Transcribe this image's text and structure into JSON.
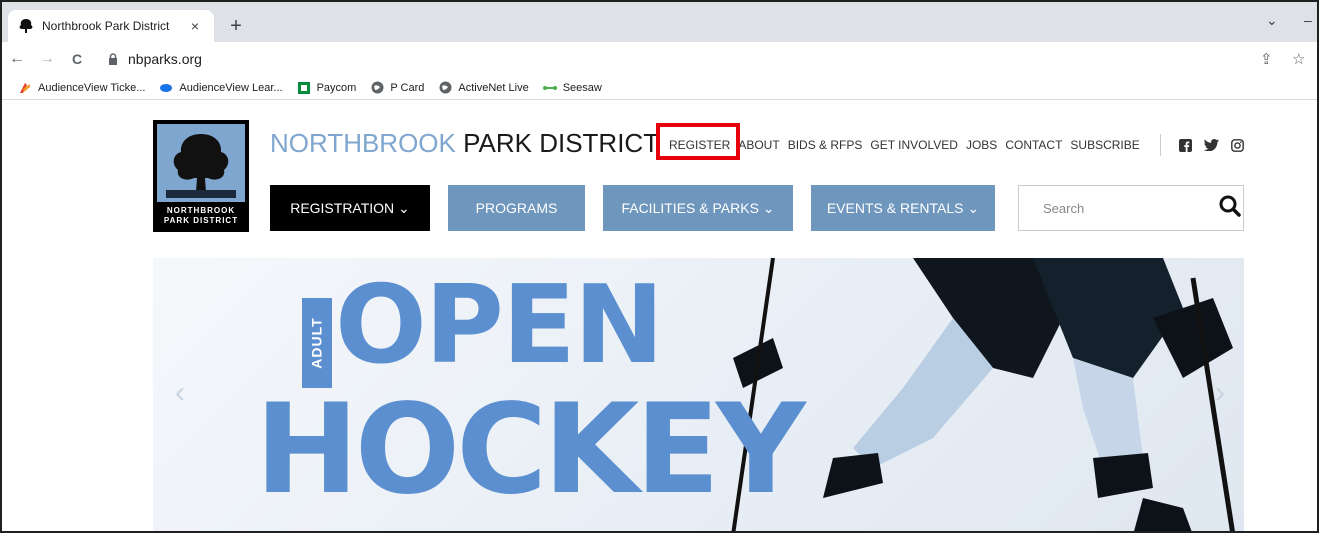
{
  "browser": {
    "tab": {
      "title": "Northbrook Park District",
      "close": "×"
    },
    "new_tab": "+",
    "window_controls": {
      "collapse": "⌄",
      "minimize": "–"
    },
    "nav": {
      "back": "←",
      "forward": "→",
      "reload": "C"
    },
    "url": "nbparks.org",
    "toolbar_icons": {
      "share": "⇪",
      "bookmark": "☆"
    },
    "bookmarks": [
      {
        "label": "AudienceView Ticke...",
        "icon": "audienceview-icon",
        "color": "#e8412b"
      },
      {
        "label": "AudienceView Lear...",
        "icon": "cloud-icon",
        "color": "#1a73e8"
      },
      {
        "label": "Paycom",
        "icon": "paycom-icon",
        "color": "#0b8a3e"
      },
      {
        "label": "P Card",
        "icon": "globe-icon",
        "color": "#5f6368"
      },
      {
        "label": "ActiveNet Live",
        "icon": "globe-icon",
        "color": "#5f6368"
      },
      {
        "label": "Seesaw",
        "icon": "seesaw-icon",
        "color": "#4caf50"
      }
    ]
  },
  "site": {
    "logo_text_line1": "NORTHBROOK",
    "logo_text_line2": "PARK DISTRICT",
    "brand_part1": "NORTHBROOK",
    "brand_part2": "PARK DISTRICT",
    "utility_links": [
      "REGISTER",
      "ABOUT",
      "BIDS & RFPS",
      "GET INVOLVED",
      "JOBS",
      "CONTACT",
      "SUBSCRIBE"
    ],
    "highlight_color": "#e5000b",
    "social": [
      "facebook-icon",
      "twitter-icon",
      "instagram-icon"
    ],
    "main_nav": [
      {
        "label": "REGISTRATION ⌄",
        "style": "dark"
      },
      {
        "label": "PROGRAMS",
        "style": "blue"
      },
      {
        "label": "FACILITIES & PARKS ⌄",
        "style": "blue"
      },
      {
        "label": "EVENTS & RENTALS ⌄",
        "style": "blue"
      }
    ],
    "search_placeholder": "Search",
    "colors": {
      "brand_blue": "#7fa6cf",
      "nav_blue": "#6f96bd",
      "hero_blue": "#5b8fd0"
    }
  },
  "hero": {
    "tag": "ADULT",
    "line1": "OPEN",
    "line2": "HOCKEY",
    "prev_arrow": "‹",
    "next_arrow": "›"
  }
}
